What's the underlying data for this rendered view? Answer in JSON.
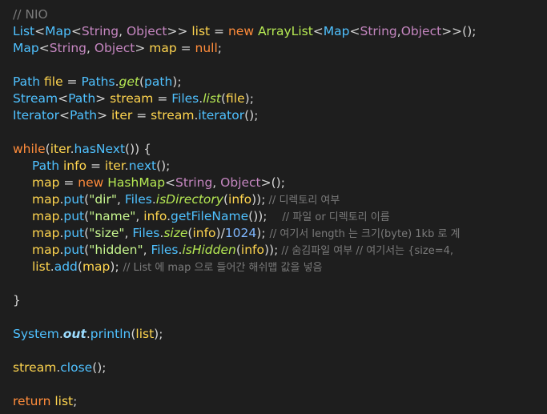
{
  "editor": {
    "lines": [
      "// NIO",
      "List<Map<String, Object>> list = new ArrayList<Map<String,Object>>();",
      "Map<String, Object> map = null;",
      "",
      "Path file = Paths.get(path);",
      "Stream<Path> stream = Files.list(file);",
      "Iterator<Path> iter = stream.iterator();",
      "",
      "while(iter.hasNext()) {",
      "Path info = iter.next();",
      "map = new HashMap<String, Object>();",
      "map.put(\"dir\", Files.isDirectory(info)); // 디렉토리 여부",
      "map.put(\"name\", info.getFileName());    // 파일 or 디렉토리 이름",
      "map.put(\"size\", Files.size(info)/1024); // 여기서 length 는 크기(byte) 1kb 로 계",
      "map.put(\"hidden\", Files.isHidden(info)); // 숨김파일 여부 // 여기서는 {size=4, ",
      "list.add(map); // List 에 map 으로 들어간 해쉬맵 값을 넣음",
      "",
      "}",
      "",
      "System.out.println(list);",
      "",
      "stream.close();",
      "",
      "return list;"
    ]
  },
  "colors": {
    "background": "#1e1e1e",
    "keyword": "#ff8c3b",
    "type": "#4fc1ff",
    "variable": "#ffd54f",
    "string": "#c6f58e",
    "comment": "#7a7a7a",
    "number": "#7fb7ff"
  }
}
